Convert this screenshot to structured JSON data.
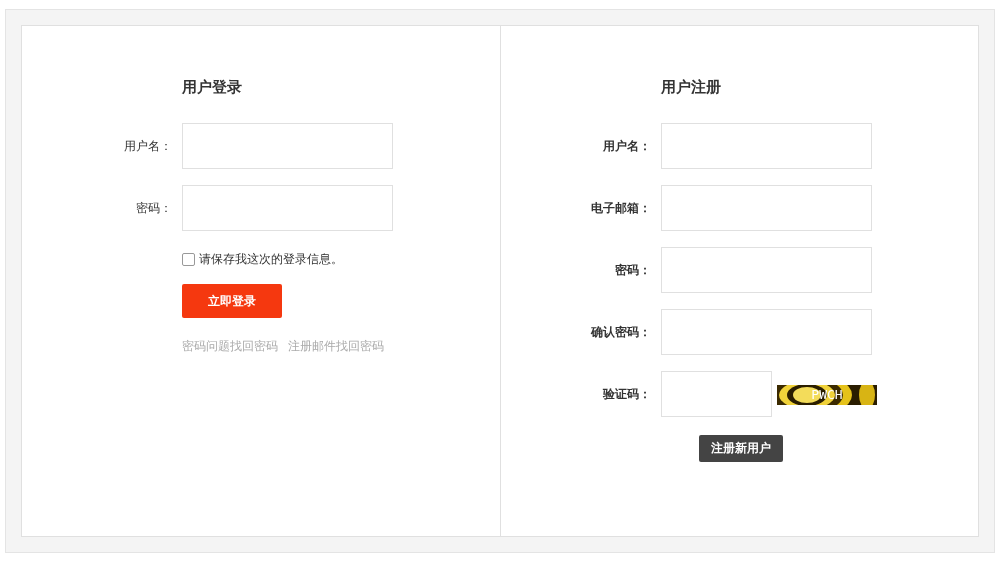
{
  "login": {
    "title": "用户登录",
    "fields": [
      {
        "label": "用户名："
      },
      {
        "label": "密码："
      }
    ],
    "remember": {
      "label": "请保存我这次的登录信息。",
      "checked": false
    },
    "submit": "立即登录",
    "links": [
      "密码问题找回密码",
      "注册邮件找回密码"
    ]
  },
  "register": {
    "title": "用户注册",
    "fields": [
      {
        "label": "用户名：",
        "kind": "text"
      },
      {
        "label": "电子邮箱：",
        "kind": "text"
      },
      {
        "label": "密码：",
        "kind": "text"
      },
      {
        "label": "确认密码：",
        "kind": "text"
      },
      {
        "label": "验证码：",
        "kind": "captcha",
        "captcha_text": "PWCH"
      }
    ],
    "submit": "注册新用户"
  }
}
